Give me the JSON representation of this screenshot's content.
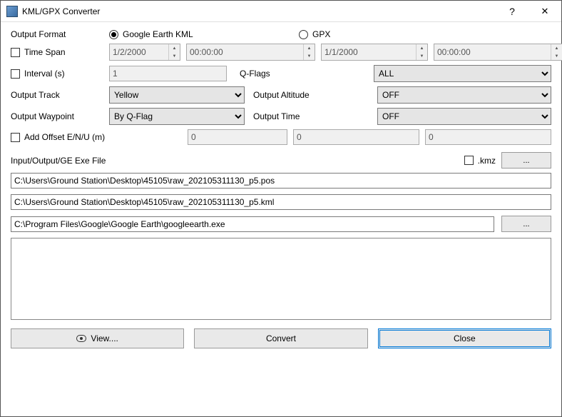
{
  "title": "KML/GPX Converter",
  "labels": {
    "output_format": "Output Format",
    "time_span": "Time Span",
    "interval": "Interval (s)",
    "qflags": "Q-Flags",
    "output_track": "Output Track",
    "output_altitude": "Output Altitude",
    "output_waypoint": "Output Waypoint",
    "output_time": "Output Time",
    "add_offset": "Add Offset E/N/U (m)",
    "io_section": "Input/Output/GE Exe File",
    "kmz": ".kmz",
    "browse": "...",
    "view": "View....",
    "convert": "Convert",
    "close": "Close"
  },
  "format": {
    "kml": "Google Earth KML",
    "gpx": "GPX",
    "selected": "kml"
  },
  "timespan": {
    "date_start": "1/2/2000",
    "time_start": "00:00:00",
    "date_end": "1/1/2000",
    "time_end": "00:00:00"
  },
  "interval_value": "1",
  "qflags_value": "ALL",
  "track_value": "Yellow",
  "altitude_value": "OFF",
  "waypoint_value": "By Q-Flag",
  "time_value": "OFF",
  "offset": {
    "e": "0",
    "n": "0",
    "u": "0"
  },
  "paths": {
    "input": "C:\\Users\\Ground Station\\Desktop\\45105\\raw_202105311130_p5.pos",
    "output": "C:\\Users\\Ground Station\\Desktop\\45105\\raw_202105311130_p5.kml",
    "ge_exe": "C:\\Program Files\\Google\\Google Earth\\googleearth.exe"
  }
}
